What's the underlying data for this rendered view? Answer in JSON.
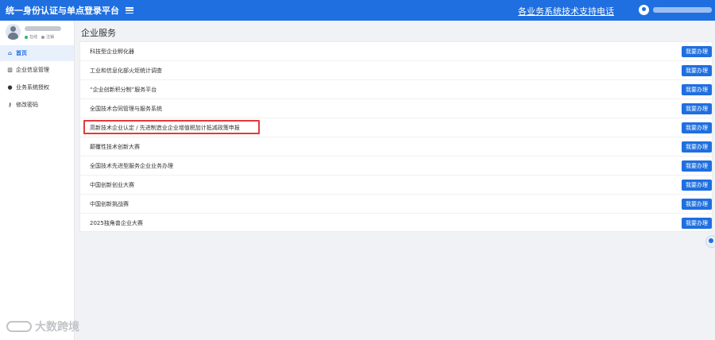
{
  "header": {
    "title": "统一身份认证与单点登录平台",
    "hotline_link": "各业务系统技术支持电话"
  },
  "sidebar": {
    "status_online": "在线",
    "status_logout": "注销",
    "items": [
      {
        "label": "首页",
        "icon": "home-icon"
      },
      {
        "label": "企业信息管理",
        "icon": "bank-icon"
      },
      {
        "label": "业务系统授权",
        "icon": "users-icon"
      },
      {
        "label": "修改密码",
        "icon": "key-icon"
      }
    ]
  },
  "main": {
    "title": "企业服务",
    "services": [
      {
        "label": "科技型企业孵化器",
        "button": "我要办理"
      },
      {
        "label": "工业和信息化部火炬统计调查",
        "button": "我要办理"
      },
      {
        "label": "“企业创新积分制”服务平台",
        "button": "我要办理"
      },
      {
        "label": "全国技术合同管理与服务系统",
        "button": "我要办理"
      },
      {
        "label": "高新技术企业认定 / 先进制造业企业增值税加计抵减政策申报",
        "button": "我要办理"
      },
      {
        "label": "颠覆性技术创新大赛",
        "button": "我要办理"
      },
      {
        "label": "全国技术先进型服务企业业务办理",
        "button": "我要办理"
      },
      {
        "label": "中国创新创业大赛",
        "button": "我要办理"
      },
      {
        "label": "中国创新挑战赛",
        "button": "我要办理"
      },
      {
        "label": "2025独角兽企业大赛",
        "button": "我要办理"
      }
    ]
  },
  "watermark": "大数跨境",
  "colors": {
    "primary": "#1f6fe0",
    "highlight": "#e4393c"
  }
}
